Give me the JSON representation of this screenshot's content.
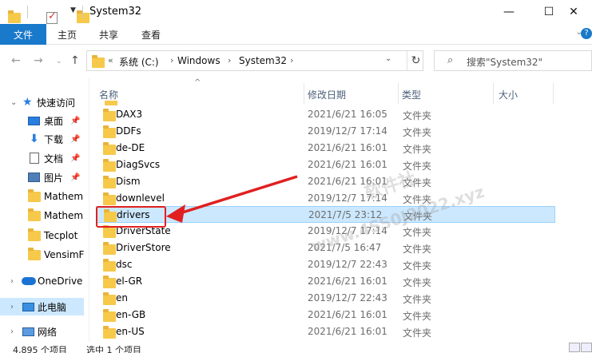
{
  "window": {
    "title": "System32",
    "controls": {
      "minimize": "—",
      "maximize": "☐",
      "close": "✕"
    }
  },
  "ribbon": {
    "file": "文件",
    "tabs": [
      "主页",
      "共享",
      "查看"
    ]
  },
  "address": {
    "overflow": "«",
    "crumbs": [
      "系统 (C:)",
      "Windows",
      "System32"
    ]
  },
  "search": {
    "placeholder": "搜索\"System32\""
  },
  "sidebar": {
    "quick_access": "快速访问",
    "items": [
      {
        "label": "桌面",
        "icon": "desktop-icon",
        "pinned": true
      },
      {
        "label": "下载",
        "icon": "download-icon",
        "pinned": true
      },
      {
        "label": "文档",
        "icon": "document-icon",
        "pinned": true
      },
      {
        "label": "图片",
        "icon": "picture-icon",
        "pinned": true
      },
      {
        "label": "Mathem",
        "icon": "folder-icon",
        "pinned": false
      },
      {
        "label": "Mathem",
        "icon": "folder-icon",
        "pinned": false
      },
      {
        "label": "Tecplot",
        "icon": "folder-icon",
        "pinned": false
      },
      {
        "label": "VensimF",
        "icon": "folder-icon",
        "pinned": false
      }
    ],
    "onedrive": "OneDrive",
    "this_pc": "此电脑",
    "network": "网络"
  },
  "columns": {
    "name": "名称",
    "date": "修改日期",
    "type": "类型",
    "size": "大小"
  },
  "files": [
    {
      "name": "DAX3",
      "date": "2021/6/21 16:05",
      "type": "文件夹"
    },
    {
      "name": "DDFs",
      "date": "2019/12/7 17:14",
      "type": "文件夹"
    },
    {
      "name": "de-DE",
      "date": "2021/6/21 16:01",
      "type": "文件夹"
    },
    {
      "name": "DiagSvcs",
      "date": "2021/6/21 16:01",
      "type": "文件夹"
    },
    {
      "name": "Dism",
      "date": "2021/6/21 16:01",
      "type": "文件夹"
    },
    {
      "name": "downlevel",
      "date": "2019/12/7 17:14",
      "type": "文件夹"
    },
    {
      "name": "drivers",
      "date": "2021/7/5 23:12",
      "type": "文件夹",
      "selected": true
    },
    {
      "name": "DriverState",
      "date": "2019/12/7 17:14",
      "type": "文件夹"
    },
    {
      "name": "DriverStore",
      "date": "2021/7/5 16:47",
      "type": "文件夹"
    },
    {
      "name": "dsc",
      "date": "2019/12/7 22:43",
      "type": "文件夹"
    },
    {
      "name": "el-GR",
      "date": "2021/6/21 16:01",
      "type": "文件夹"
    },
    {
      "name": "en",
      "date": "2019/12/7 22:43",
      "type": "文件夹"
    },
    {
      "name": "en-GB",
      "date": "2021/6/21 16:01",
      "type": "文件夹"
    },
    {
      "name": "en-US",
      "date": "2021/6/21 16:01",
      "type": "文件夹"
    }
  ],
  "watermark": {
    "line1": "软件社",
    "line2": "www.4SS0J2022.xyz"
  },
  "status": {
    "count": "4,895 个项目",
    "selected": "选中 1 个项目"
  },
  "colors": {
    "accent": "#1979ca",
    "selection": "#cce8ff",
    "annotation": "#e02020"
  }
}
